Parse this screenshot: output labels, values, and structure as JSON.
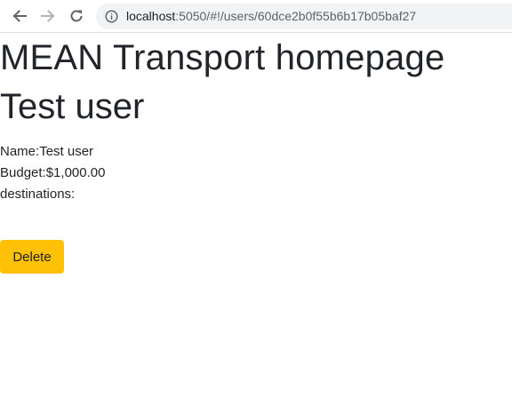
{
  "browser": {
    "url_host": "localhost",
    "url_rest": ":5050/#!/users/60dce2b0f55b6b17b05baf27",
    "icons": {
      "back": "arrow-left-icon",
      "forward": "arrow-right-icon",
      "reload": "reload-icon",
      "site_info": "info-icon"
    }
  },
  "page": {
    "title": "MEAN Transport homepage",
    "user_heading": "Test user",
    "name_label": "Name:",
    "name_value": "Test user",
    "budget_label": "Budget:",
    "budget_value": "$1,000.00",
    "destinations_label": "destinations:",
    "delete_label": "Delete"
  },
  "colors": {
    "delete_button": "#ffc107",
    "text": "#212529"
  }
}
